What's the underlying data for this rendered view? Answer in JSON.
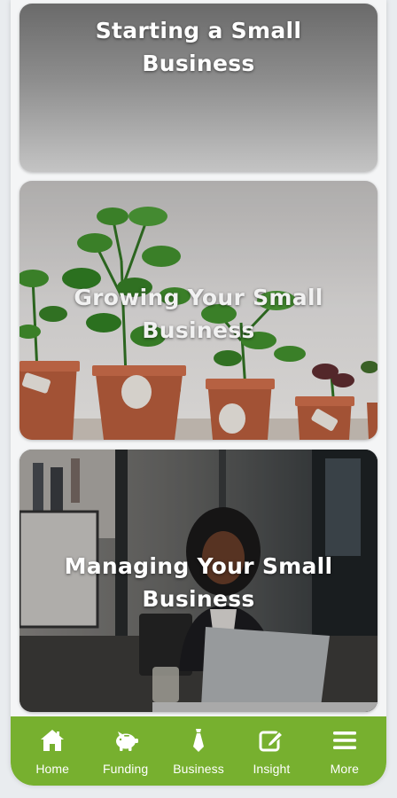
{
  "cards": [
    {
      "title": "Starting a Small Business",
      "image": "gray-gradient"
    },
    {
      "title": "Growing Your Small Business",
      "image": "potted-plants-photo"
    },
    {
      "title": "Managing Your Small Business",
      "image": "woman-with-laptop-photo"
    }
  ],
  "nav": {
    "accent": "#77b02f",
    "items": [
      {
        "label": "Home",
        "icon": "home-icon"
      },
      {
        "label": "Funding",
        "icon": "piggy-bank-icon"
      },
      {
        "label": "Business",
        "icon": "necktie-icon"
      },
      {
        "label": "Insight",
        "icon": "edit-icon"
      },
      {
        "label": "More",
        "icon": "menu-icon"
      }
    ]
  }
}
